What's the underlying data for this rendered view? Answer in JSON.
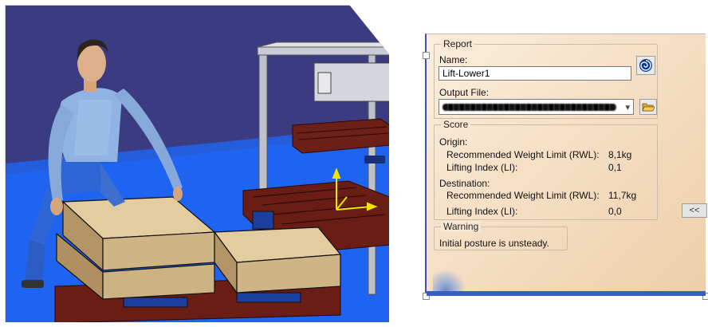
{
  "report": {
    "title": "Report",
    "name_label": "Name:",
    "name_value": "Lift-Lower1",
    "output_file_label": "Output File:",
    "output_file_value_redacted": true,
    "icons": {
      "analysis": "swirl-icon",
      "browse": "open-folder-icon"
    }
  },
  "score": {
    "title": "Score",
    "origin_label": "Origin:",
    "origin": {
      "rwl_label": "Recommended Weight Limit (RWL):",
      "rwl_value": "8,1kg",
      "li_label": "Lifting Index (LI):",
      "li_value": "0,1"
    },
    "destination_label": "Destination:",
    "destination": {
      "rwl_label": "Recommended Weight Limit (RWL):",
      "rwl_value": "11,7kg",
      "li_label": "Lifting Index (LI):",
      "li_value": "0,0"
    }
  },
  "collapse_button_label": "<<",
  "warning": {
    "title": "Warning",
    "message": "Initial posture is unsteady."
  },
  "colors": {
    "floor": "#1e63f2",
    "wall": "#3a3a80",
    "box": "#cfb88c",
    "pallet": "#6b1e14",
    "dialog_bg": "#f7e4cc",
    "dialog_accent": "#355fc4"
  }
}
